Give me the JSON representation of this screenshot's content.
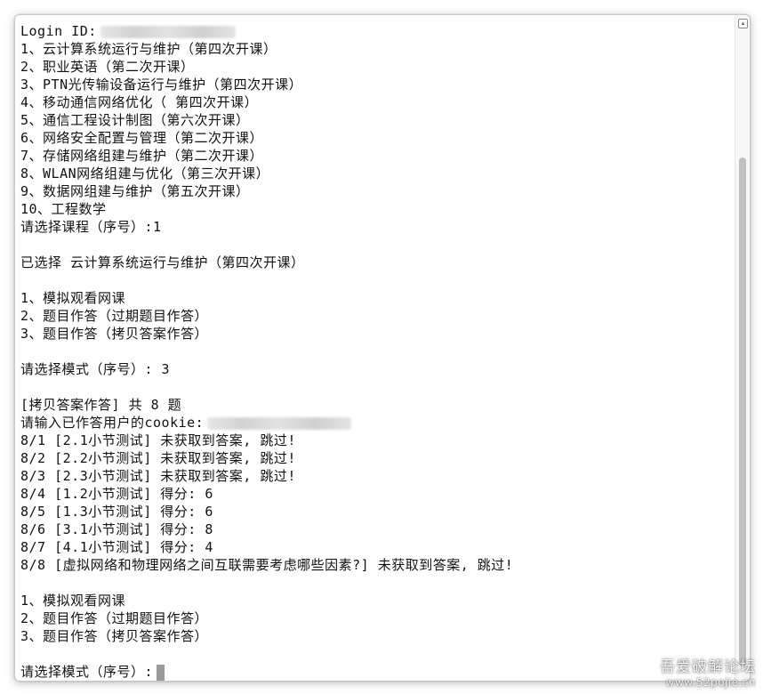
{
  "terminal": {
    "login_label": "Login ID:",
    "lines": [
      "1、云计算系统运行与维护（第四次开课）",
      "2、职业英语（第二次开课）",
      "3、PTN光传输设备运行与维护（第四次开课）",
      "4、移动通信网络优化（ 第四次开课）",
      "5、通信工程设计制图（第六次开课）",
      "6、网络安全配置与管理（第二次开课）",
      "7、存储网络组建与维护（第二次开课）",
      "8、WLAN网络组建与优化（第三次开课）",
      "9、数据网组建与维护（第五次开课）",
      "10、工程数学",
      "请选择课程（序号）:1",
      "",
      "已选择 云计算系统运行与维护（第四次开课）",
      "",
      "1、模拟观看网课",
      "2、题目作答（过期题目作答）",
      "3、题目作答（拷贝答案作答）",
      "",
      "请选择模式（序号）: 3",
      "",
      "[拷贝答案作答] 共 8 题",
      "",
      "8/1 [2.1小节测试] 未获取到答案, 跳过!",
      "8/2 [2.2小节测试] 未获取到答案, 跳过!",
      "8/3 [2.3小节测试] 未获取到答案, 跳过!",
      "8/4 [1.2小节测试] 得分: 6",
      "8/5 [1.3小节测试] 得分: 6",
      "8/6 [3.1小节测试] 得分: 8",
      "8/7 [4.1小节测试] 得分: 4",
      "8/8 [虚拟网络和物理网络之间互联需要考虑哪些因素?] 未获取到答案, 跳过!",
      "",
      "1、模拟观看网课",
      "2、题目作答（过期题目作答）",
      "3、题目作答（拷贝答案作答）",
      "",
      ""
    ],
    "cookie_prompt": "请输入已作答用户的cookie:",
    "final_prompt": "请选择模式（序号）:"
  },
  "watermark": {
    "title": "吾爱破解论坛",
    "url": "www.52pojie.cn"
  }
}
